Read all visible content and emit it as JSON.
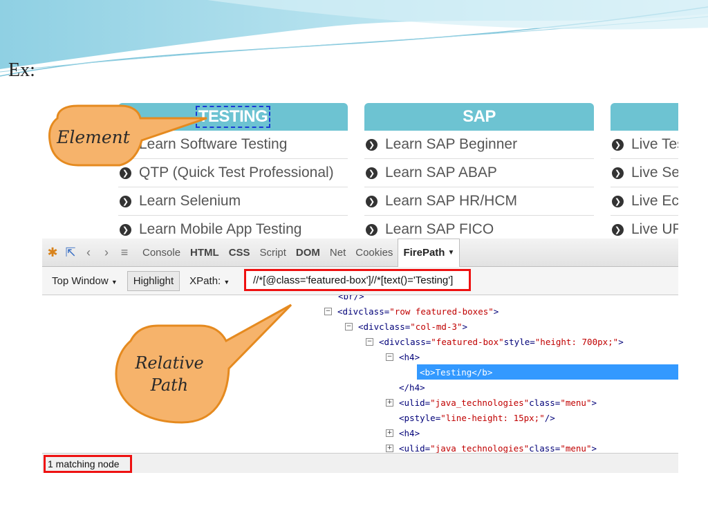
{
  "slide": {
    "label": "Ex:"
  },
  "site": {
    "columns": [
      {
        "heading": "TESTING",
        "items": [
          "Learn Software Testing",
          "QTP (Quick Test Professional)",
          "Learn Selenium",
          "Learn Mobile App Testing"
        ]
      },
      {
        "heading": "SAP",
        "items": [
          "Learn SAP Beginner",
          "Learn SAP ABAP",
          "Learn SAP HR/HCM",
          "Learn SAP FICO"
        ]
      },
      {
        "heading": "",
        "items": [
          "Live Tes",
          "Live Sel",
          "Live Ecc",
          "Live UF"
        ]
      }
    ]
  },
  "callouts": {
    "element": "Element",
    "relative_path_line1": "Relative",
    "relative_path_line2": "Path"
  },
  "firebug": {
    "tabs": [
      "Console",
      "HTML",
      "CSS",
      "Script",
      "DOM",
      "Net",
      "Cookies",
      "FirePath"
    ],
    "toolbar": {
      "top_window": "Top Window",
      "highlight": "Highlight",
      "xpath_label": "XPath:",
      "xpath_value": "//*[@class='featured-box']//*[text()='Testing']"
    },
    "tree": [
      {
        "tag": "<br/>"
      },
      {
        "open": "<div ",
        "attr": "class=",
        "val": "\"row featured-boxes\"",
        "close": ">"
      },
      {
        "open": "<div ",
        "attr": "class=",
        "val": "\"col-md-3\"",
        "close": ">"
      },
      {
        "open": "<div ",
        "attr": "class=",
        "val": "\"featured-box\"",
        "attr2": " style=",
        "val2": "\"height: 700px;\"",
        "close": ">"
      },
      {
        "tag": "<h4>"
      },
      {
        "tag": "<b>Testing</b>"
      },
      {
        "tag": "</h4>"
      },
      {
        "open": "<ul ",
        "attr": "id=",
        "val": "\"java_technologies\"",
        "attr2": " class=",
        "val2": "\"menu\"",
        "close": ">"
      },
      {
        "open": "<p ",
        "attr": "style=",
        "val": "\"line-height: 15px;\"",
        "close": "/>"
      },
      {
        "tag": "<h4>"
      },
      {
        "open": "<ul ",
        "attr": "id=",
        "val": "\"java_technologies\"",
        "attr2": " class=",
        "val2": "\"menu\"",
        "close": ">"
      }
    ],
    "status": "1 matching node"
  },
  "colors": {
    "accent": "#6dc3d2",
    "highlight_red": "#e11111",
    "selection": "#3399ff",
    "callout": "#f6b36b"
  }
}
